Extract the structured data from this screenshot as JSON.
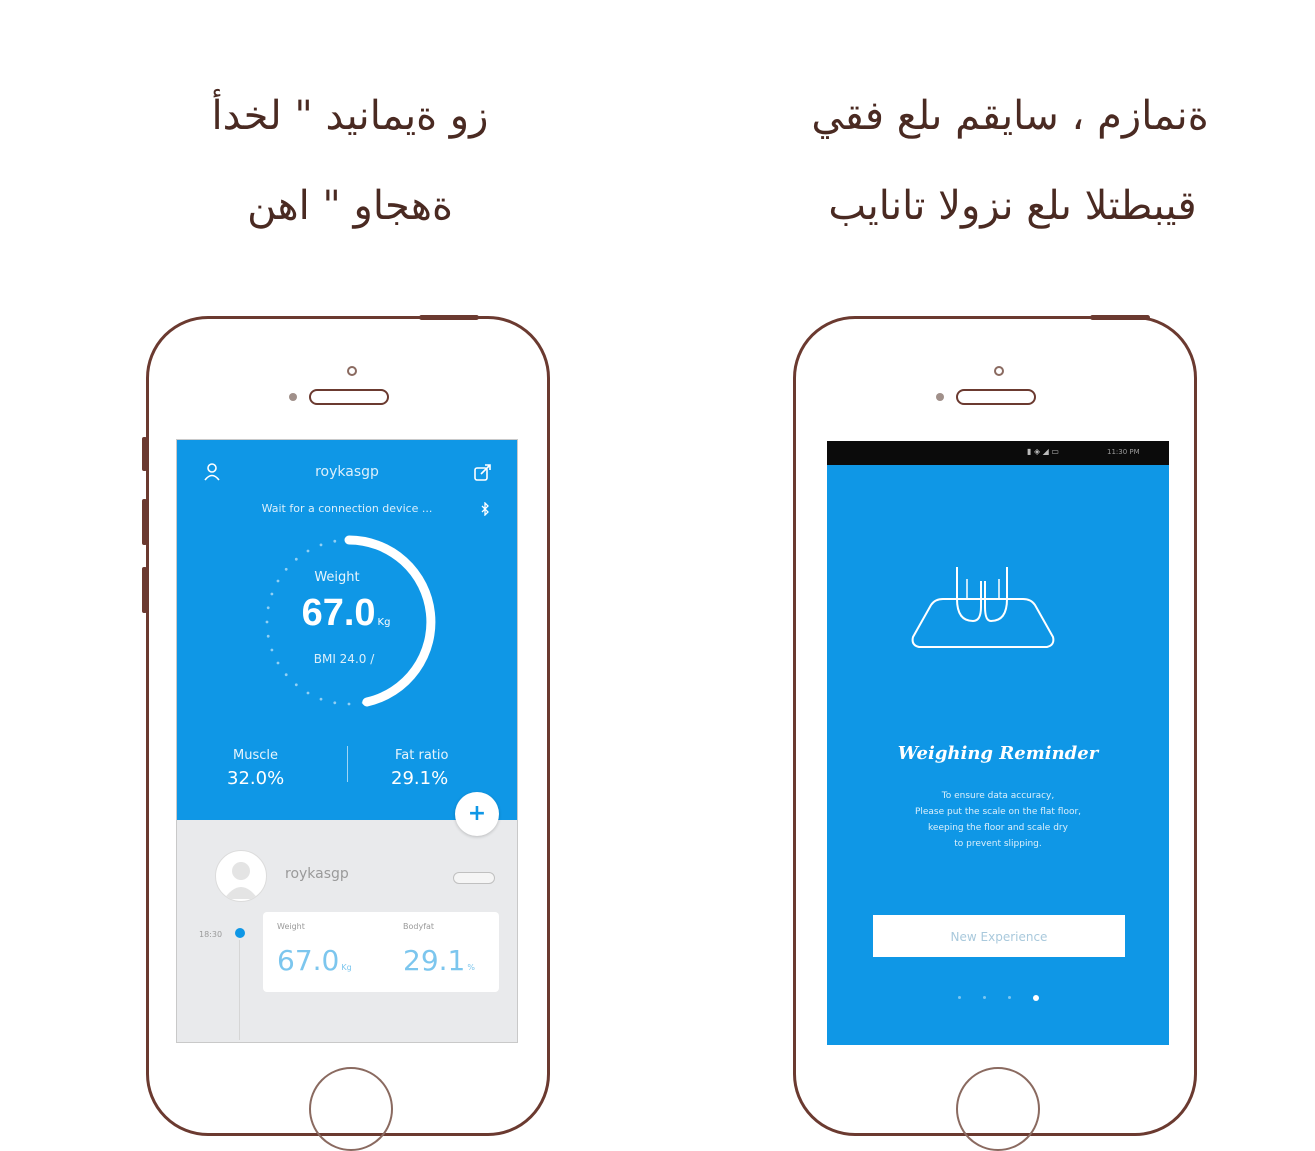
{
  "captions": {
    "left_line1": "زو ةيماني‍د \" لخدأ",
    "left_line2": "ةهجاو \" اه‍ن",
    "right_line1": "ةنمازم ، ساي‍قم ى‍لع ف‍قي",
    "right_line2": "قي‍بطتلا ى‍لع نزولا تانايب"
  },
  "left_screen": {
    "username": "roykasgp",
    "status": "Wait for a connection device ...",
    "weight_label": "Weight",
    "weight_value": "67.0",
    "weight_unit": "Kg",
    "bmi_text": "BMI 24.0 /",
    "muscle_label": "Muscle",
    "muscle_value": "32.0%",
    "fat_label": "Fat ratio",
    "fat_value": "29.1%",
    "plus_label": "+",
    "card_username": "roykasgp",
    "time_label": "18:30",
    "card_weight_label": "Weight",
    "card_weight_value": "67.0",
    "card_weight_unit": "Kg",
    "card_fat_label": "Bodyfat",
    "card_fat_value": "29.1",
    "card_fat_unit": "%",
    "progress_fraction": 0.62
  },
  "right_screen": {
    "status_icons": "▮ ◈ ◢ ▭",
    "status_time": "11:30 PM",
    "title": "Weighing Reminder",
    "body": [
      "To ensure data accuracy,",
      "Please put the scale on the flat floor,",
      "keeping the floor and scale dry",
      "to prevent slipping."
    ],
    "button_label": "New Experience",
    "page_count": 4,
    "active_page": 4
  },
  "colors": {
    "accent_blue": "#0f97e6",
    "phone_outline": "#6b3a30",
    "caption_text": "#4a2a22"
  },
  "icons": [
    "user-icon",
    "share-icon",
    "bluetooth-icon",
    "scale-feet-icon",
    "plus-icon",
    "avatar-icon"
  ]
}
